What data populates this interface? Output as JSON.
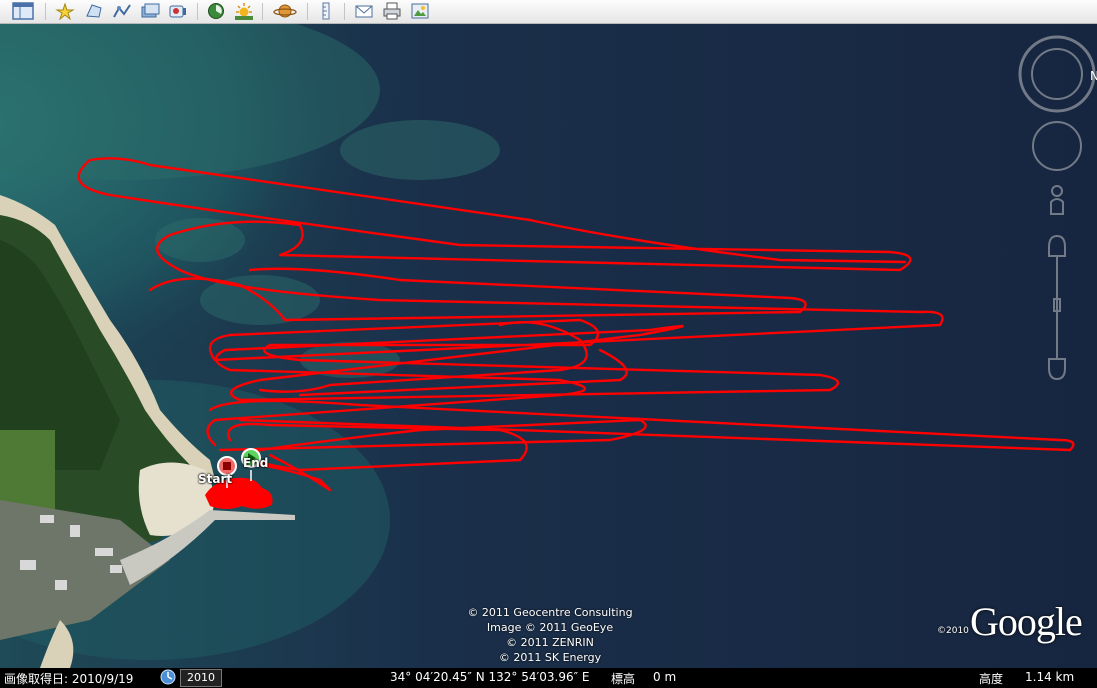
{
  "toolbar": {
    "icons": [
      "sidebar-toggle-icon",
      "placemark-icon",
      "polygon-icon",
      "path-icon",
      "overlay-icon",
      "tour-icon",
      "historical-imagery-icon",
      "sun-icon",
      "planet-icon",
      "ruler-icon",
      "email-icon",
      "print-icon",
      "save-image-icon"
    ]
  },
  "map": {
    "markers": {
      "start_label": "Start",
      "end_label": "End"
    },
    "copyrights": [
      "© 2011 Geocentre Consulting",
      "Image © 2011 GeoEye",
      "© 2011 ZENRIN",
      "© 2011 SK Energy"
    ],
    "logo": {
      "year": "©2010",
      "brand": "Google"
    },
    "track_color": "#ff0000"
  },
  "status": {
    "image_date": "画像取得日: 2010/9/19",
    "timeline_year": "2010",
    "coordinates": "34° 04′20.45″ N 132° 54′03.96″ E",
    "elevation_label": "標高",
    "elevation_value": "0 m",
    "altitude_label": "高度",
    "altitude_value": "1.14 km"
  }
}
